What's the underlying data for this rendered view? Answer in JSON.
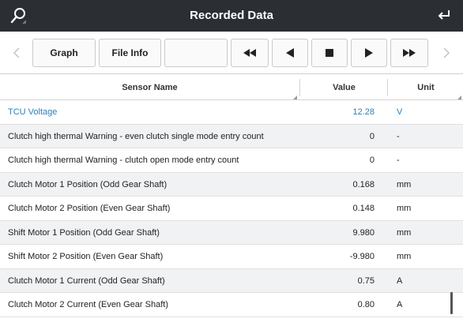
{
  "header": {
    "title": "Recorded Data"
  },
  "toolbar": {
    "graph_label": "Graph",
    "fileinfo_label": "File Info",
    "empty_label": ""
  },
  "table": {
    "columns": {
      "name": "Sensor Name",
      "value": "Value",
      "unit": "Unit"
    },
    "rows": [
      {
        "name": "TCU Voltage",
        "value": "12.28",
        "unit": "V"
      },
      {
        "name": "Clutch high thermal Warning - even clutch single mode entry count",
        "value": "0",
        "unit": "-"
      },
      {
        "name": "Clutch high thermal Warning - clutch open mode entry count",
        "value": "0",
        "unit": "-"
      },
      {
        "name": "Clutch Motor 1 Position (Odd Gear Shaft)",
        "value": "0.168",
        "unit": "mm"
      },
      {
        "name": "Clutch Motor 2 Position (Even Gear Shaft)",
        "value": "0.148",
        "unit": "mm"
      },
      {
        "name": "Shift Motor 1 Position (Odd Gear Shaft)",
        "value": "9.980",
        "unit": "mm"
      },
      {
        "name": "Shift Motor 2 Position (Even Gear Shaft)",
        "value": "-9.980",
        "unit": "mm"
      },
      {
        "name": "Clutch Motor 1 Current (Odd Gear Shaft)",
        "value": "0.75",
        "unit": "A"
      },
      {
        "name": "Clutch Motor 2 Current (Even Gear Shaft)",
        "value": "0.80",
        "unit": "A"
      }
    ]
  },
  "colors": {
    "header_bg": "#2b2e33",
    "accent": "#2a80b9",
    "alt_row": "#f1f2f4"
  },
  "icons": {
    "search": "search-icon",
    "back": "return-icon",
    "prev_nav": "chevron-left-icon",
    "next_nav": "chevron-right-icon",
    "rewind": "rewind-icon",
    "step_back": "step-back-icon",
    "stop": "stop-icon",
    "play": "play-icon",
    "fast_forward": "fast-forward-icon"
  }
}
